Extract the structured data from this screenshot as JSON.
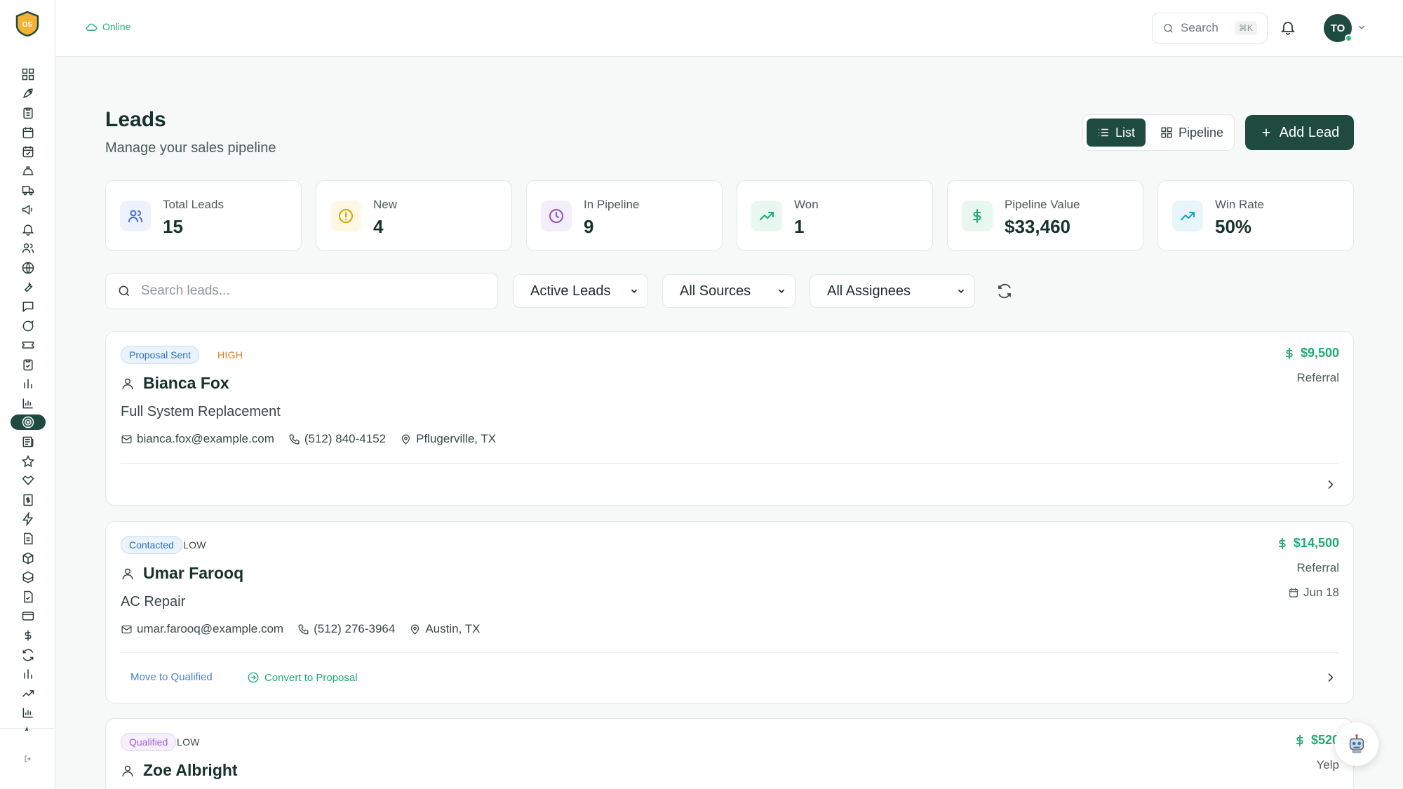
{
  "header": {
    "status": "Online",
    "search_label": "Search",
    "search_shortcut": "⌘K",
    "avatar_initials": "TO"
  },
  "logo_text": "OS",
  "page": {
    "title": "Leads",
    "subtitle": "Manage your sales pipeline"
  },
  "view_toggle": {
    "list": "List",
    "pipeline": "Pipeline",
    "active": "List"
  },
  "add_button": "Add Lead",
  "stats": [
    {
      "label": "Total Leads",
      "value": "15",
      "icon": "users-icon",
      "color": "#4a6cd4",
      "bg": "#eef2fc"
    },
    {
      "label": "New",
      "value": "4",
      "icon": "alert-circle-icon",
      "color": "#d9a300",
      "bg": "#fdf7e3"
    },
    {
      "label": "In Pipeline",
      "value": "9",
      "icon": "clock-icon",
      "color": "#8b54c7",
      "bg": "#f4eefb"
    },
    {
      "label": "Won",
      "value": "1",
      "icon": "trending-up-icon",
      "color": "#1faa74",
      "bg": "#e8f7f0"
    },
    {
      "label": "Pipeline Value",
      "value": "$33,460",
      "icon": "dollar-icon",
      "color": "#1faa74",
      "bg": "#e8f7f0"
    },
    {
      "label": "Win Rate",
      "value": "50%",
      "icon": "trending-up-icon",
      "color": "#1a9fc0",
      "bg": "#e6f6fa"
    }
  ],
  "filters": {
    "search_placeholder": "Search leads...",
    "status": "Active Leads",
    "source": "All Sources",
    "assignee": "All Assignees"
  },
  "leads": [
    {
      "status": "Proposal Sent",
      "priority": "HIGH",
      "name": "Bianca Fox",
      "service": "Full System Replacement",
      "email": "bianca.fox@example.com",
      "phone": "(512) 840-4152",
      "location": "Pflugerville, TX",
      "value": "$9,500",
      "source": "Referral",
      "date": "",
      "actions": []
    },
    {
      "status": "Contacted",
      "priority": "LOW",
      "name": "Umar Farooq",
      "service": "AC Repair",
      "email": "umar.farooq@example.com",
      "phone": "(512) 276-3964",
      "location": "Austin, TX",
      "value": "$14,500",
      "source": "Referral",
      "date": "Jun 18",
      "actions": [
        "Move to Qualified",
        "Convert to Proposal"
      ]
    },
    {
      "status": "Qualified",
      "priority": "LOW",
      "name": "Zoe Albright",
      "service": "",
      "email": "",
      "phone": "",
      "location": "",
      "value": "$520",
      "source": "Yelp",
      "date": "",
      "actions": []
    }
  ],
  "colors": {
    "brand": "#1f4a3f",
    "accent_green": "#1faa74",
    "high": "#e07b1f"
  }
}
